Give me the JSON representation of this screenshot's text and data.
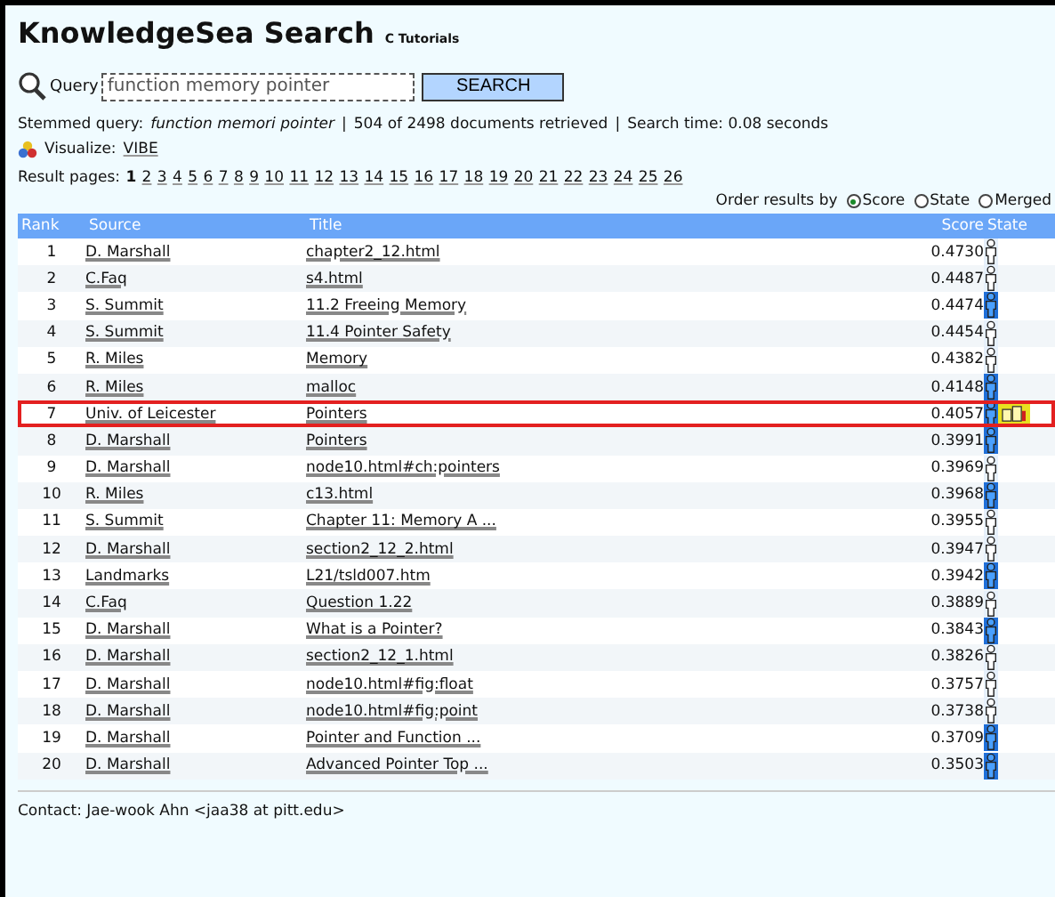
{
  "header": {
    "title": "KnowledgeSea Search",
    "subtitle": "C Tutorials"
  },
  "search": {
    "label": "Query",
    "value": "function memory pointer",
    "button": "SEARCH"
  },
  "summary": {
    "stemmed_label": "Stemmed query:",
    "stemmed": "function memori pointer",
    "separator": "|",
    "retrieved": "504 of 2498 documents retrieved",
    "time": "Search time: 0.08 seconds"
  },
  "visualize": {
    "label": "Visualize:",
    "link": "VIBE"
  },
  "pages": {
    "label": "Result pages:",
    "items": [
      {
        "label": "1",
        "selected": true
      },
      {
        "label": "2",
        "selected": false
      },
      {
        "label": "3",
        "selected": false
      },
      {
        "label": "4",
        "selected": false
      },
      {
        "label": "5",
        "selected": false
      },
      {
        "label": "6",
        "selected": false
      },
      {
        "label": "7",
        "selected": false
      },
      {
        "label": "8",
        "selected": false
      },
      {
        "label": "9",
        "selected": false
      },
      {
        "label": "10",
        "selected": false
      },
      {
        "label": "11",
        "selected": false
      },
      {
        "label": "12",
        "selected": false
      },
      {
        "label": "13",
        "selected": false
      },
      {
        "label": "14",
        "selected": false
      },
      {
        "label": "15",
        "selected": false
      },
      {
        "label": "16",
        "selected": false
      },
      {
        "label": "17",
        "selected": false
      },
      {
        "label": "18",
        "selected": false
      },
      {
        "label": "19",
        "selected": false
      },
      {
        "label": "20",
        "selected": false
      },
      {
        "label": "21",
        "selected": false
      },
      {
        "label": "22",
        "selected": false
      },
      {
        "label": "23",
        "selected": false
      },
      {
        "label": "24",
        "selected": false
      },
      {
        "label": "25",
        "selected": false
      },
      {
        "label": "26",
        "selected": false
      }
    ]
  },
  "order": {
    "label": "Order results by",
    "options": [
      {
        "label": "Score",
        "selected": true
      },
      {
        "label": "State",
        "selected": false
      },
      {
        "label": "Merged",
        "selected": false
      }
    ]
  },
  "table": {
    "columns": [
      "Rank",
      "Source",
      "Title",
      "Score",
      "State"
    ],
    "rows": [
      {
        "rank": "1",
        "source": "D. Marshall",
        "title": "chapter2_12.html",
        "score": "0.4730",
        "visited": false,
        "selected": false
      },
      {
        "rank": "2",
        "source": "C.Faq",
        "title": "s4.html",
        "score": "0.4487",
        "visited": false,
        "selected": false
      },
      {
        "rank": "3",
        "source": "S. Summit",
        "title": "11.2 Freeing Memory",
        "score": "0.4474",
        "visited": true,
        "selected": false
      },
      {
        "rank": "4",
        "source": "S. Summit",
        "title": "11.4 Pointer Safety",
        "score": "0.4454",
        "visited": false,
        "selected": false
      },
      {
        "rank": "5",
        "source": "R. Miles",
        "title": "Memory",
        "score": "0.4382",
        "visited": false,
        "selected": false
      },
      {
        "rank": "6",
        "source": "R. Miles",
        "title": "malloc",
        "score": "0.4148",
        "visited": true,
        "selected": false
      },
      {
        "rank": "7",
        "source": "Univ. of Leicester",
        "title": "Pointers",
        "score": "0.4057",
        "visited": true,
        "selected": true
      },
      {
        "rank": "8",
        "source": "D. Marshall",
        "title": "Pointers",
        "score": "0.3991",
        "visited": true,
        "selected": false
      },
      {
        "rank": "9",
        "source": "D. Marshall",
        "title": "node10.html#ch:pointers",
        "score": "0.3969",
        "visited": false,
        "selected": false
      },
      {
        "rank": "10",
        "source": "R. Miles",
        "title": "c13.html",
        "score": "0.3968",
        "visited": true,
        "selected": false
      },
      {
        "rank": "11",
        "source": "S. Summit",
        "title": "Chapter 11: Memory A ...",
        "score": "0.3955",
        "visited": false,
        "selected": false
      },
      {
        "rank": "12",
        "source": "D. Marshall",
        "title": "section2_12_2.html",
        "score": "0.3947",
        "visited": false,
        "selected": false
      },
      {
        "rank": "13",
        "source": "Landmarks",
        "title": "L21/tsld007.htm",
        "score": "0.3942",
        "visited": true,
        "selected": false
      },
      {
        "rank": "14",
        "source": "C.Faq",
        "title": "Question 1.22",
        "score": "0.3889",
        "visited": false,
        "selected": false
      },
      {
        "rank": "15",
        "source": "D. Marshall",
        "title": "What is a Pointer?",
        "score": "0.3843",
        "visited": true,
        "selected": false
      },
      {
        "rank": "16",
        "source": "D. Marshall",
        "title": "section2_12_1.html",
        "score": "0.3826",
        "visited": false,
        "selected": false
      },
      {
        "rank": "17",
        "source": "D. Marshall",
        "title": "node10.html#fig:float",
        "score": "0.3757",
        "visited": false,
        "selected": false
      },
      {
        "rank": "18",
        "source": "D. Marshall",
        "title": "node10.html#fig:point",
        "score": "0.3738",
        "visited": false,
        "selected": false
      },
      {
        "rank": "19",
        "source": "D. Marshall",
        "title": "Pointer and Function ...",
        "score": "0.3709",
        "visited": true,
        "selected": false
      },
      {
        "rank": "20",
        "source": "D. Marshall",
        "title": "Advanced Pointer Top ...",
        "score": "0.3503",
        "visited": true,
        "selected": false
      }
    ]
  },
  "footer": {
    "contact": "Contact: Jae-wook Ahn <jaa38 at pitt.edu>"
  }
}
